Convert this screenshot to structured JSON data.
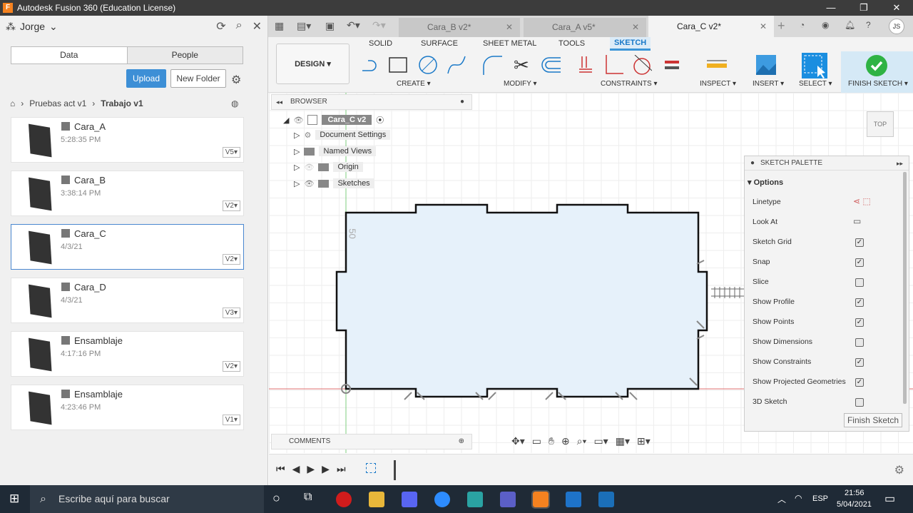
{
  "window": {
    "title": "Autodesk Fusion 360 (Education License)"
  },
  "left_panel": {
    "user": "Jorge",
    "tabs": [
      "Data",
      "People"
    ],
    "upload": "Upload",
    "new_folder": "New Folder",
    "breadcrumb": [
      "Pruebas act v1",
      "Trabajo v1"
    ],
    "items": [
      {
        "name": "Cara_A",
        "time": "5:28:35 PM",
        "version": "V5"
      },
      {
        "name": "Cara_B",
        "time": "3:38:14 PM",
        "version": "V2"
      },
      {
        "name": "Cara_C",
        "time": "4/3/21",
        "version": "V2",
        "selected": true
      },
      {
        "name": "Cara_D",
        "time": "4/3/21",
        "version": "V3"
      },
      {
        "name": "Ensamblaje",
        "time": "4:17:16 PM",
        "version": "V2"
      },
      {
        "name": "Ensamblaje",
        "time": "4:23:46 PM",
        "version": "V1"
      }
    ]
  },
  "tabs": [
    {
      "label": "Cara_B v2*"
    },
    {
      "label": "Cara_A v5*"
    },
    {
      "label": "Cara_C v2*",
      "active": true
    }
  ],
  "user_initials": "JS",
  "toolbar": {
    "workspace": "DESIGN ▾",
    "tabs": [
      "SOLID",
      "SURFACE",
      "SHEET METAL",
      "TOOLS",
      "SKETCH"
    ],
    "groups": [
      "CREATE ▾",
      "MODIFY ▾",
      "CONSTRAINTS ▾",
      "INSPECT ▾",
      "INSERT ▾",
      "SELECT ▾",
      "FINISH SKETCH ▾"
    ]
  },
  "browser": {
    "title": "BROWSER",
    "root": "Cara_C v2",
    "items": [
      "Document Settings",
      "Named Views",
      "Origin",
      "Sketches"
    ]
  },
  "comments": "COMMENTS",
  "viewcube": "TOP",
  "dimension_label": "50",
  "palette": {
    "title": "SKETCH PALETTE",
    "section": "Options",
    "finish": "Finish Sketch",
    "options": [
      {
        "label": "Linetype"
      },
      {
        "label": "Look At"
      },
      {
        "label": "Sketch Grid",
        "checked": true
      },
      {
        "label": "Snap",
        "checked": true
      },
      {
        "label": "Slice",
        "checked": false
      },
      {
        "label": "Show Profile",
        "checked": true
      },
      {
        "label": "Show Points",
        "checked": true
      },
      {
        "label": "Show Dimensions",
        "checked": false
      },
      {
        "label": "Show Constraints",
        "checked": true
      },
      {
        "label": "Show Projected Geometries",
        "checked": true
      },
      {
        "label": "3D Sketch",
        "checked": false
      }
    ]
  },
  "taskbar": {
    "search": "Escribe aquí para buscar",
    "lang": "ESP",
    "time": "21:56",
    "date": "5/04/2021"
  },
  "colors": {
    "accent": "#3b95d8",
    "profile_fill": "#e6f1fa",
    "finish_green": "#2fb344"
  }
}
